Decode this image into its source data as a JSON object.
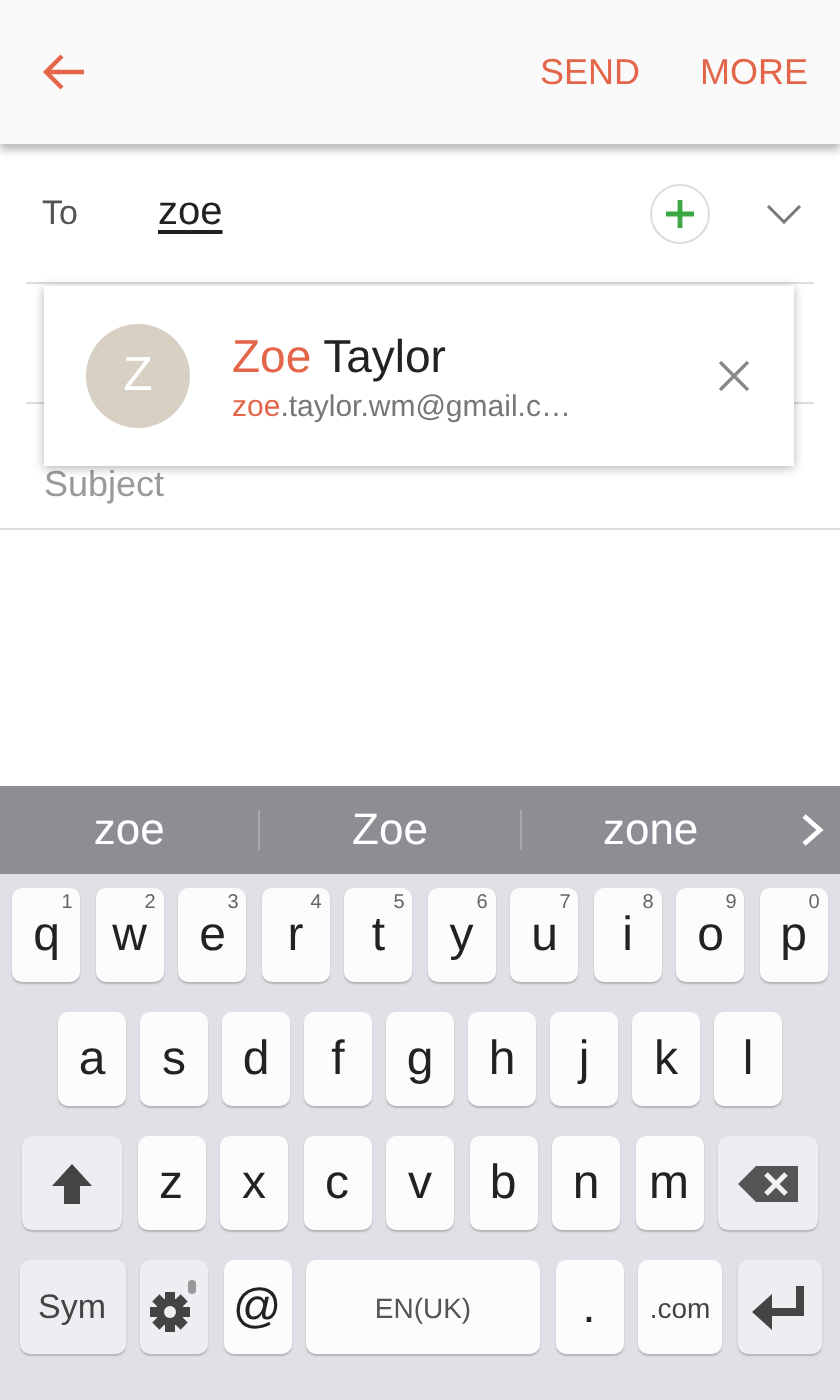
{
  "header": {
    "actions": [
      "SEND",
      "MORE"
    ]
  },
  "to": {
    "label": "To",
    "value": "zoe"
  },
  "subject": {
    "placeholder": "Subject"
  },
  "suggestion": {
    "initial": "Z",
    "name": {
      "match": "Zoe",
      "rest": "Taylor"
    },
    "email": {
      "match": "zoe",
      "rest": ".taylor.wm@gmail.c…"
    }
  },
  "predictions": [
    "zoe",
    "Zoe",
    "zone"
  ],
  "keyboard": [
    [
      {
        "kind": "letter",
        "label": "q",
        "hint": "1"
      },
      {
        "kind": "letter",
        "label": "w",
        "hint": "2"
      },
      {
        "kind": "letter",
        "label": "e",
        "hint": "3"
      },
      {
        "kind": "letter",
        "label": "r",
        "hint": "4"
      },
      {
        "kind": "letter",
        "label": "t",
        "hint": "5"
      },
      {
        "kind": "letter",
        "label": "y",
        "hint": "6"
      },
      {
        "kind": "letter",
        "label": "u",
        "hint": "7"
      },
      {
        "kind": "letter",
        "label": "i",
        "hint": "8"
      },
      {
        "kind": "letter",
        "label": "o",
        "hint": "9"
      },
      {
        "kind": "letter",
        "label": "p",
        "hint": "0"
      }
    ],
    [
      {
        "kind": "letter",
        "label": "a"
      },
      {
        "kind": "letter",
        "label": "s"
      },
      {
        "kind": "letter",
        "label": "d"
      },
      {
        "kind": "letter",
        "label": "f"
      },
      {
        "kind": "letter",
        "label": "g"
      },
      {
        "kind": "letter",
        "label": "h"
      },
      {
        "kind": "letter",
        "label": "j"
      },
      {
        "kind": "letter",
        "label": "k"
      },
      {
        "kind": "letter",
        "label": "l"
      }
    ],
    [
      {
        "kind": "shift"
      },
      {
        "kind": "letter",
        "label": "z"
      },
      {
        "kind": "letter",
        "label": "x"
      },
      {
        "kind": "letter",
        "label": "c"
      },
      {
        "kind": "letter",
        "label": "v"
      },
      {
        "kind": "letter",
        "label": "b"
      },
      {
        "kind": "letter",
        "label": "n"
      },
      {
        "kind": "letter",
        "label": "m"
      },
      {
        "kind": "backspace"
      }
    ],
    [
      {
        "kind": "sym",
        "label": "Sym"
      },
      {
        "kind": "settings"
      },
      {
        "kind": "letter",
        "label": "@"
      },
      {
        "kind": "space",
        "label": "EN(UK)"
      },
      {
        "kind": "letter",
        "label": "."
      },
      {
        "kind": "domain",
        "label": ".com"
      },
      {
        "kind": "enter"
      }
    ]
  ]
}
